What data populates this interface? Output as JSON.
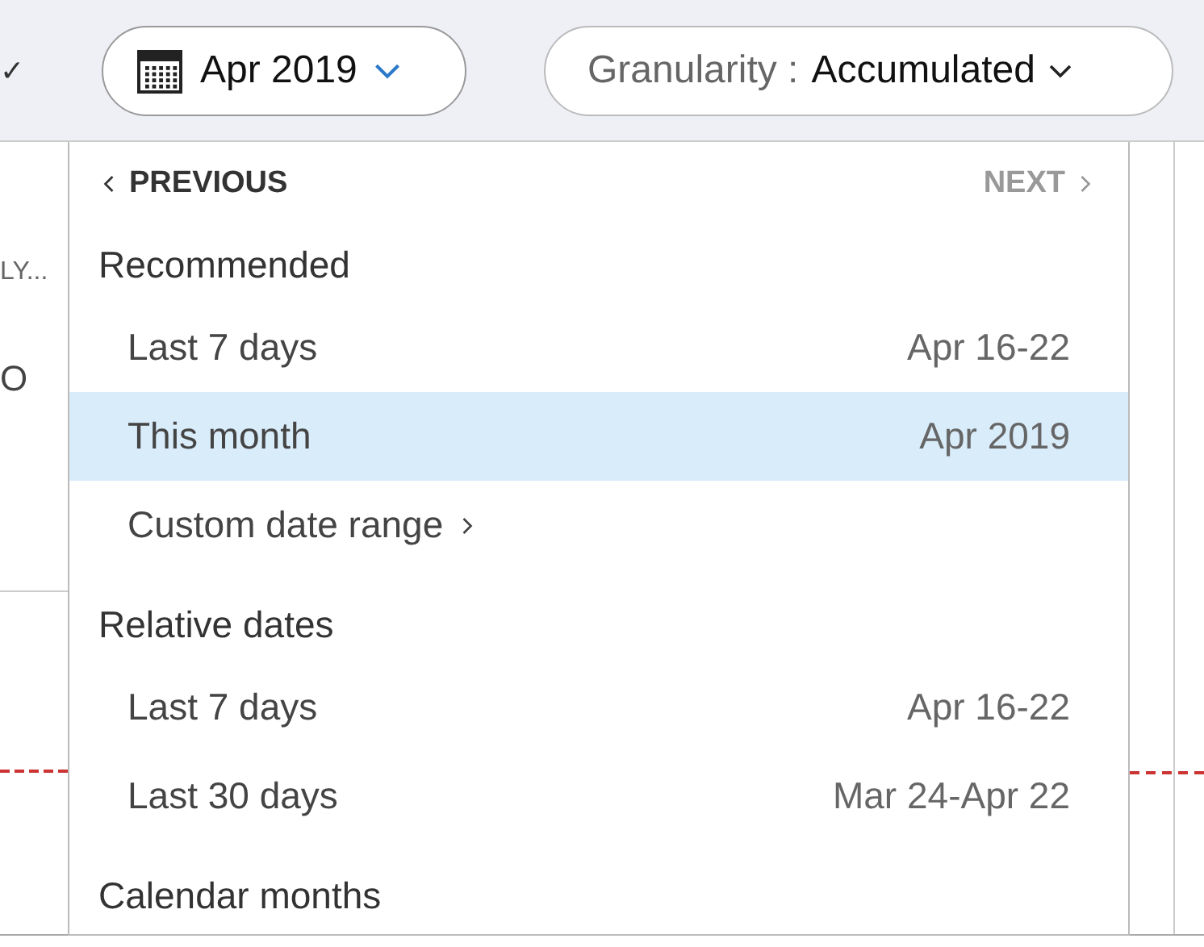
{
  "toolbar": {
    "left_chevron": "✓",
    "date_picker": {
      "label": "Apr 2019",
      "open": true
    },
    "granularity": {
      "label": "Granularity",
      "separator": ":",
      "value": "Accumulated"
    }
  },
  "background": {
    "column_label": "LY...",
    "cell_text": "O"
  },
  "date_menu": {
    "previous": {
      "label": "PREVIOUS",
      "disabled": false
    },
    "next": {
      "label": "NEXT",
      "disabled": true
    },
    "sections": [
      {
        "title": "Recommended",
        "items": [
          {
            "kind": "range",
            "label": "Last 7 days",
            "value": "Apr 16-22",
            "selected": false
          },
          {
            "kind": "range",
            "label": "This month",
            "value": "Apr 2019",
            "selected": true
          },
          {
            "kind": "submenu",
            "label": "Custom date range",
            "selected": false
          }
        ]
      },
      {
        "title": "Relative dates",
        "items": [
          {
            "kind": "range",
            "label": "Last 7 days",
            "value": "Apr 16-22",
            "selected": false
          },
          {
            "kind": "range",
            "label": "Last 30 days",
            "value": "Mar 24-Apr 22",
            "selected": false
          }
        ]
      },
      {
        "title": "Calendar months"
      }
    ]
  }
}
